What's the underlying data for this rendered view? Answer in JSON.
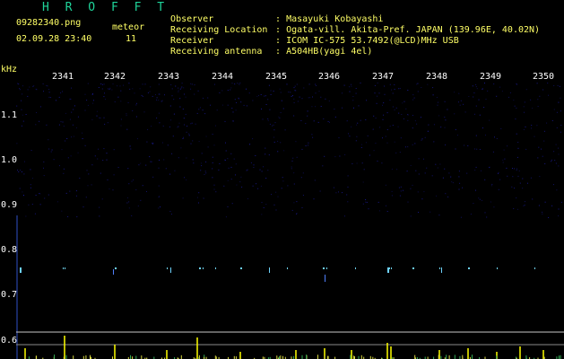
{
  "header": {
    "brand": "H R O F F T",
    "filename": "09282340.png",
    "timestamp": "02.09.28 23:40",
    "meteor_label": "meteor",
    "meteor_count": "11"
  },
  "info": [
    {
      "label": "Observer",
      "value": ": Masayuki Kobayashi"
    },
    {
      "label": "Receiving Location",
      "value": ": Ogata-vill. Akita-Pref. JAPAN (139.96E, 40.02N)"
    },
    {
      "label": "Receiver",
      "value": ": ICOM IC-575 53.7492(@LCD)MHz USB"
    },
    {
      "label": "Receiving antenna",
      "value": ": A504HB(yagi 4el)"
    }
  ],
  "axis": {
    "unit": "kHz",
    "x_ticks": [
      "2341",
      "2342",
      "2343",
      "2344",
      "2345",
      "2346",
      "2347",
      "2348",
      "2349",
      "2350"
    ],
    "y_ticks": [
      "1.1",
      "1.0",
      "0.9",
      "0.8",
      "0.7",
      "0.6"
    ]
  },
  "colors": {
    "background": "#000000",
    "brand": "#1fd49a",
    "text": "#ffff66",
    "axis_tick": "#ffffff",
    "noise": "#1a1a90",
    "echo": "#6fd3ff",
    "spike": "#ffff00",
    "baseline": "#c8c8c8"
  }
}
